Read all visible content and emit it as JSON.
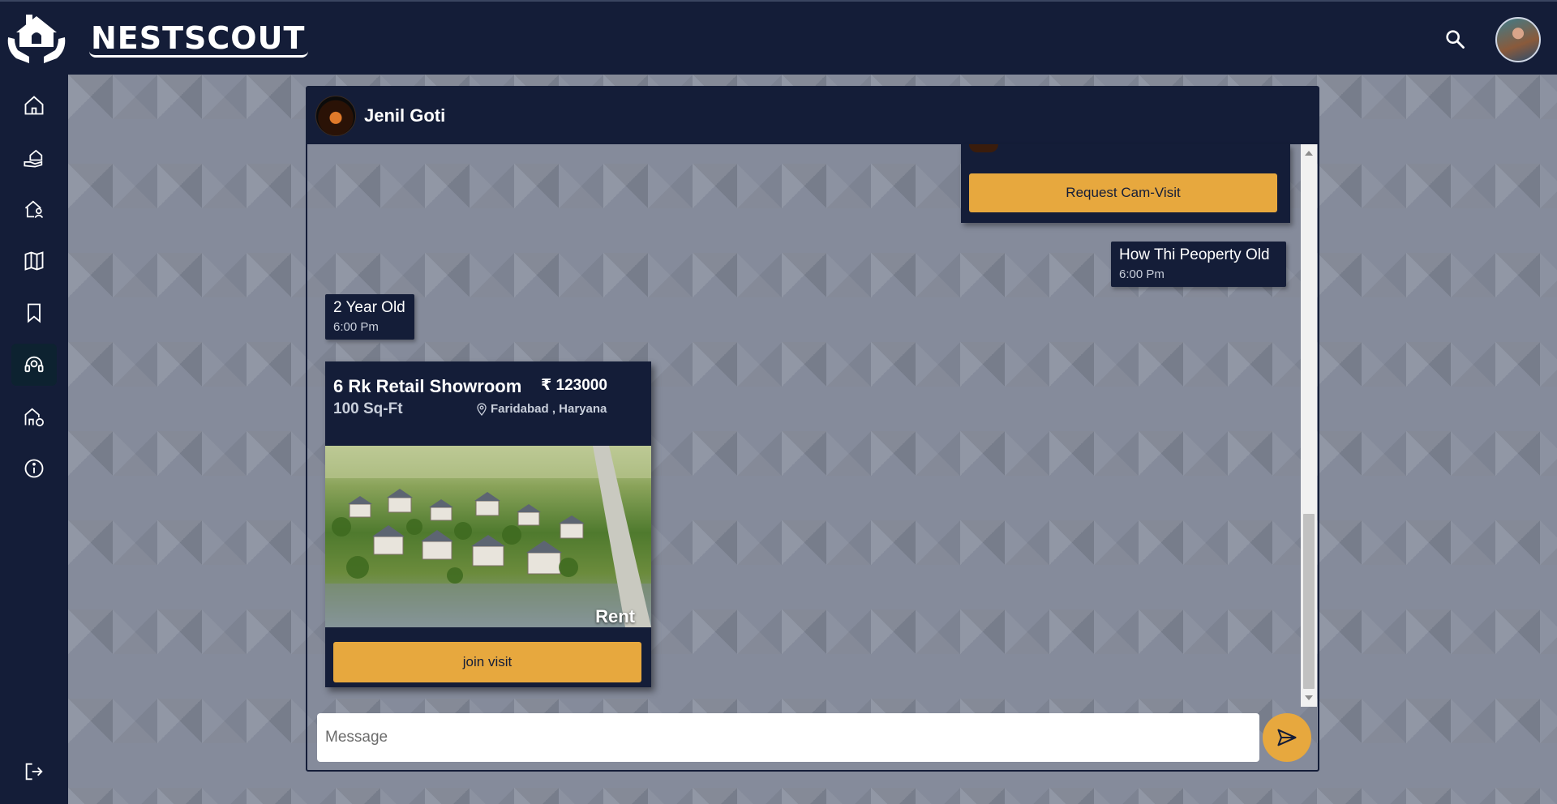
{
  "app": {
    "brand": "NESTSCOUT"
  },
  "header": {
    "search_icon": "search-icon",
    "avatar": "user-avatar"
  },
  "sidebar": {
    "items": [
      {
        "name": "home",
        "icon": "home-icon"
      },
      {
        "name": "sell-property",
        "icon": "hand-house-icon"
      },
      {
        "name": "my-properties",
        "icon": "user-house-icon"
      },
      {
        "name": "map",
        "icon": "map-icon"
      },
      {
        "name": "saved",
        "icon": "bookmark-icon"
      },
      {
        "name": "support",
        "icon": "headset-icon",
        "active": true
      },
      {
        "name": "properties-manage",
        "icon": "building-settings-icon"
      },
      {
        "name": "about",
        "icon": "info-icon"
      }
    ],
    "logout_icon": "logout-icon"
  },
  "chat": {
    "contact_name": "Jenil Goti",
    "partial_card": {
      "button_label": "Request Cam-Visit"
    },
    "messages": [
      {
        "side": "right",
        "text": "How Thi Peoperty Old",
        "time": "6:00 Pm"
      },
      {
        "side": "left",
        "text": "2 Year Old",
        "time": "6:00 Pm"
      }
    ],
    "property_card": {
      "title": "6 Rk Retail Showroom",
      "area": "100 Sq-Ft",
      "price": "₹ 123000",
      "location": "Faridabad , Haryana",
      "listing_type": "Rent",
      "button_label": "join visit"
    },
    "composer": {
      "placeholder": "Message",
      "value": ""
    }
  },
  "colors": {
    "navy": "#141d38",
    "accent": "#e7a83e"
  }
}
